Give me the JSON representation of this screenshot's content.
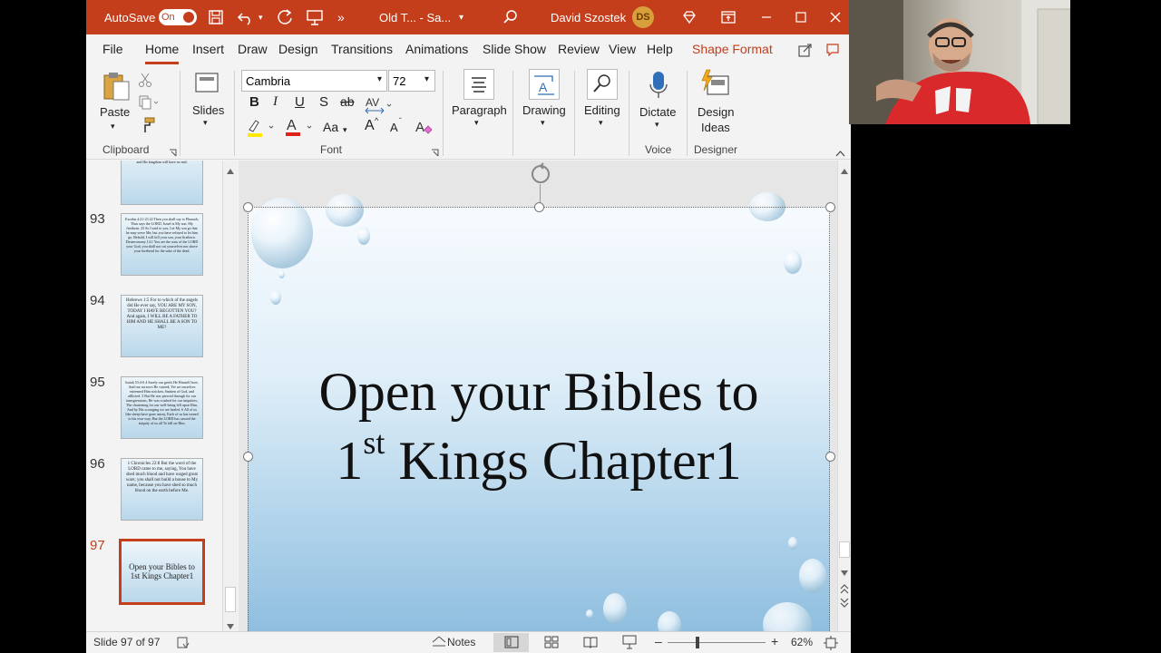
{
  "titlebar": {
    "autosave_label": "AutoSave",
    "autosave_state": "On",
    "doc_title": "Old T... - Sa...",
    "user_name": "David Szostek",
    "user_initials": "DS",
    "color": "#c43e1c"
  },
  "menu": {
    "tabs": [
      "File",
      "Home",
      "Insert",
      "Draw",
      "Design",
      "Transitions",
      "Animations",
      "Slide Show",
      "Review",
      "View",
      "Help",
      "Shape Format"
    ],
    "active": "Home"
  },
  "ribbon": {
    "paste": "Paste",
    "clipboard": "Clipboard",
    "slides": "Slides",
    "font_name": "Cambria",
    "font_size": "72",
    "font": "Font",
    "bold": "B",
    "italic": "I",
    "underline": "U",
    "shadow": "S",
    "strike": "ab",
    "aa": "Aa",
    "grow": "A",
    "shrink": "A",
    "paragraph": "Paragraph",
    "drawing": "Drawing",
    "editing": "Editing",
    "dictate": "Dictate",
    "voice": "Voice",
    "design_ideas_1": "Design",
    "design_ideas_2": "Ideas",
    "designer": "Designer"
  },
  "thumbnails": [
    {
      "num": "",
      "text": "called the Son of the Most High; and the Lord God will give Him the throne of His father David; 33 and He will reign over the house of Jacob forever, and His kingdom will have no end."
    },
    {
      "num": "93",
      "text": "Exodus 4:21-23 22 Then you shall say to Pharaoh, Thus says the LORD, Israel is My son, My firstborn. 23 So I said to you, Let My son go that he may serve Me; but you have refused to let him go. Behold, I will kill your son, your firstborn. Deuteronomy 14:1 You are the sons of the LORD your God; you shall not cut yourselves nor shave your forehead for the sake of the dead."
    },
    {
      "num": "94",
      "text": "Hebrews 1:5 For to which of the angels did He ever say, YOU ARE MY SON, TODAY I HAVE BEGOTTEN YOU? And again, I WILL BE A FATHER TO HIM AND HE SHALL BE A SON TO ME?"
    },
    {
      "num": "95",
      "text": "Isaiah 53:4-6 4 Surely our griefs He Himself bore, And our sorrows He carried; Yet we ourselves esteemed Him stricken, Smitten of God, and afflicted. 5 But He was pierced through for our transgressions, He was crushed for our iniquities; The chastening for our well-being fell upon Him, And by His scourging we are healed. 6 All of us like sheep have gone astray, Each of us has turned to his own way; But the LORD has caused the iniquity of us all To fall on Him."
    },
    {
      "num": "96",
      "text": "1 Chronicles 22:8 But the word of the LORD came to me, saying, You have shed much blood and have waged great wars; you shall not build a house to My name, because you have shed so much blood on the earth before Me."
    },
    {
      "num": "97",
      "text": "Open your Bibles to 1st Kings Chapter1"
    }
  ],
  "slide": {
    "line1": "Open your Bibles to",
    "line2_num": "1",
    "line2_sup": "st",
    "line2_rest": " Kings Chapter1"
  },
  "status": {
    "slide_of": "Slide 97 of 97",
    "notes": "Notes",
    "zoom": "62%"
  }
}
